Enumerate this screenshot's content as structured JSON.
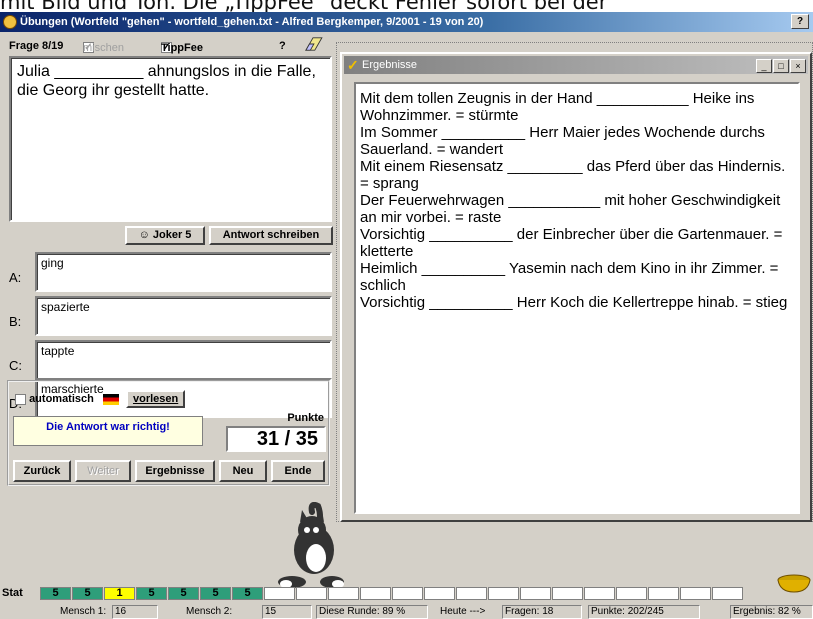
{
  "top_text": "mit Bild und Ton. Die „TippFee\" deckt Fehler sofort bei der",
  "window": {
    "title": "Übungen (Wortfeld \"gehen\" - wortfeld_gehen.txt - Alfred Bergkemper, 9/2001 - 19 von 20)",
    "help": "?"
  },
  "question": {
    "counter": "Frage 8/19",
    "mischen": "mischen",
    "tippfee": "TippFee",
    "help": "?",
    "text": "Julia __________ ahnungslos in die Falle, die Georg ihr gestellt hatte."
  },
  "buttons": {
    "joker": "Joker 5",
    "antwort": "Antwort schreiben",
    "zurueck": "Zurück",
    "weiter": "Weiter",
    "ergebnisse": "Ergebnisse",
    "neu": "Neu",
    "ende": "Ende",
    "vorlesen": "vorlesen"
  },
  "answers": [
    {
      "letter": "A:",
      "text": "ging"
    },
    {
      "letter": "B:",
      "text": "spazierte"
    },
    {
      "letter": "C:",
      "text": "tappte"
    },
    {
      "letter": "D:",
      "text": "marschierte"
    }
  ],
  "controls": {
    "automatisch": "automatisch",
    "feedback": "Die Antwort war richtig!",
    "punkte_label": "Punkte",
    "score": "31 / 35"
  },
  "results": {
    "title": "Ergebnisse",
    "lines": [
      "Mit dem tollen Zeugnis in der Hand ___________ Heike ins Wohnzimmer. = stürmte",
      "Im Sommer __________ Herr Maier jedes Wochende durchs Sauerland. = wandert",
      "Mit einem Riesensatz _________ das Pferd über das Hindernis. = sprang",
      "Der Feuerwehrwagen ___________ mit hoher Geschwindigkeit an mir vorbei. = raste",
      "Vorsichtig __________ der Einbrecher über die Gartenmauer. = kletterte",
      "Heimlich __________ Yasemin nach dem Kino in ihr Zimmer. = schlich",
      "Vorsichtig __________ Herr Koch die Kellertreppe hinab. = stieg"
    ]
  },
  "progress": {
    "start": "Stat",
    "cells": [
      "5",
      "5",
      "1",
      "5",
      "5",
      "5",
      "5",
      "",
      "",
      "",
      "",
      "",
      "",
      "",
      "",
      "",
      "",
      "",
      "",
      "",
      "",
      ""
    ],
    "colors": [
      "green",
      "green",
      "yellow",
      "green",
      "green",
      "green",
      "green",
      "",
      "",
      "",
      "",
      "",
      "",
      "",
      "",
      "",
      "",
      "",
      "",
      "",
      "",
      ""
    ]
  },
  "status": {
    "mensch1_label": "Mensch 1:",
    "mensch1_value": "16",
    "mensch2_label": "Mensch 2:",
    "mensch2_value": "15",
    "runde": "Diese Runde: 89 %",
    "heute": "Heute --->",
    "fragen": "Fragen: 18",
    "punkte": "Punkte: 202/245",
    "ergebnis": "Ergebnis: 82 %"
  }
}
